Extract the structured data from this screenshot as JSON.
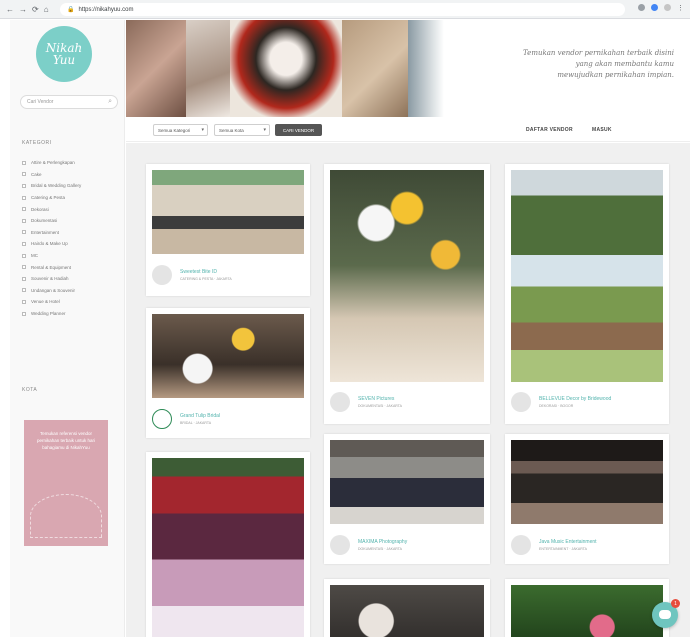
{
  "browser": {
    "url": "https://nikahyuu.com",
    "nav_icons": [
      "back-icon",
      "forward-icon",
      "reload-icon",
      "home-icon"
    ]
  },
  "sidebar": {
    "logo_line1": "Nikah",
    "logo_line2": "Yuu",
    "search_placeholder": "Cari Vendor",
    "category_heading": "KATEGORI",
    "categories": [
      "Attire & Perlengkapan",
      "Cake",
      "Bridal & Wedding Gallery",
      "Catering & Pesta",
      "Dekorasi",
      "Dokumentasi",
      "Entertainment",
      "Hairdo & Make Up",
      "MC",
      "Rental & Equipment",
      "Souvenir & Hadiah",
      "Undangan & Souvenir",
      "Venue & Hotel",
      "Wedding Planner"
    ],
    "city_heading": "KOTA",
    "promo_text": "Temukan referensi vendor pernikahan terbaik untuk hari bahagiamu di NikahYuu"
  },
  "hero": {
    "tagline_line1": "Temukan vendor pernikahan terbaik disini",
    "tagline_line2": "yang akan membantu kamu",
    "tagline_line3": "mewujudkan pernikahan impian."
  },
  "filter": {
    "category_select": "Semua Kategori",
    "city_select": "Semua Kota",
    "search_button": "CARI VENDOR",
    "link_register": "DAFTAR VENDOR",
    "link_login": "MASUK"
  },
  "cards": [
    {
      "name": "Sweetest Bite ID",
      "sub": "CATERING & PESTA · JAKARTA"
    },
    {
      "name": "Grand Tulip Bridal",
      "sub": "BRIDAL · JAKARTA"
    },
    {
      "name": "",
      "sub": ""
    },
    {
      "name": "SEVEN Pictures",
      "sub": "DOKUMENTASI · JAKARTA"
    },
    {
      "name": "MAXIMA Photography",
      "sub": "DOKUMENTASI · JAKARTA"
    },
    {
      "name": "",
      "sub": ""
    },
    {
      "name": "BELLEVUE Decor by Bridewood",
      "sub": "DEKORASI · BOGOR"
    },
    {
      "name": "Java Music Entertainment",
      "sub": "ENTERTAINMENT · JAKARTA"
    },
    {
      "name": "",
      "sub": ""
    }
  ],
  "chat": {
    "badge": "1"
  }
}
